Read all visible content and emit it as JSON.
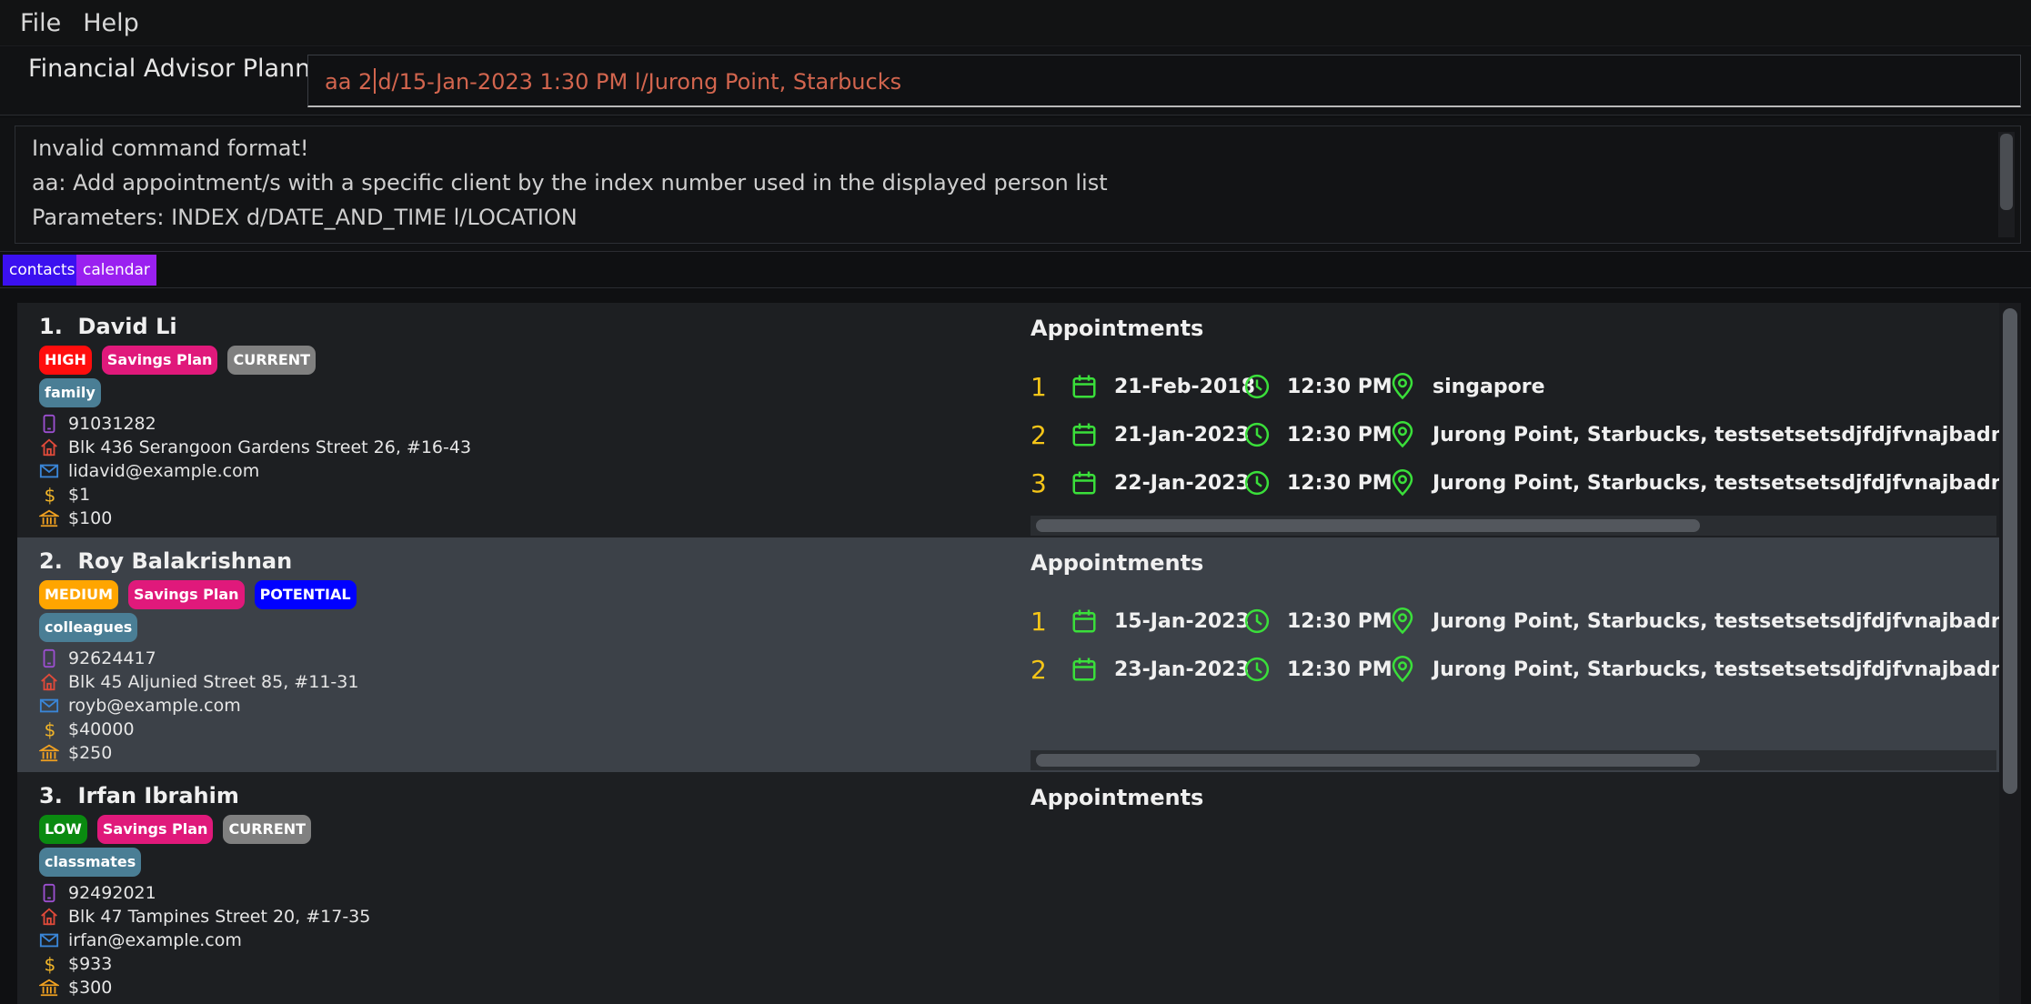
{
  "menu": {
    "file": "File",
    "help": "Help"
  },
  "app_title": "Financial Advisor Planner",
  "command": {
    "before_cursor": "aa 2",
    "after_cursor": "d/15-Jan-2023 1:30 PM l/Jurong Point, Starbucks"
  },
  "result": {
    "line1": "Invalid command format!",
    "line2": "aa: Add appointment/s with a specific client by the index number used in the displayed person list",
    "line3": "Parameters: INDEX d/DATE_AND_TIME l/LOCATION"
  },
  "tabs": {
    "contacts": "contacts",
    "calendar": "calendar"
  },
  "appointments_heading": "Appointments",
  "colors": {
    "high": "#ff0d0d",
    "medium": "#ffa500",
    "low": "#0a8a10",
    "plan": "#e0197b",
    "current": "#808080",
    "potential": "#0000ff",
    "group": "#4a7e95",
    "accent_green": "#3adf3a",
    "index_yellow": "#f5c518"
  },
  "persons": [
    {
      "index": "1.",
      "name": "David Li",
      "risk": "HIGH",
      "plan": "Savings Plan",
      "status": "CURRENT",
      "group": "family",
      "phone": "91031282",
      "address": "Blk 436 Serangoon Gardens Street 26, #16-43",
      "email": "lidavid@example.com",
      "income": "$1",
      "monthly": "$100",
      "appointments": [
        {
          "idx": "1",
          "date": "21-Feb-2018",
          "time": "12:30 PM",
          "location": "singapore"
        },
        {
          "idx": "2",
          "date": "21-Jan-2023",
          "time": "12:30 PM",
          "location": "Jurong Point, Starbucks, testsetsetsdjfdjfvnajbadnb jsdfnvnas"
        },
        {
          "idx": "3",
          "date": "22-Jan-2023",
          "time": "12:30 PM",
          "location": "Jurong Point, Starbucks, testsetsetsdjfdjfvnajbadnb jsdfnvnas"
        }
      ]
    },
    {
      "index": "2.",
      "name": "Roy Balakrishnan",
      "risk": "MEDIUM",
      "plan": "Savings Plan",
      "status": "POTENTIAL",
      "group": "colleagues",
      "phone": "92624417",
      "address": "Blk 45 Aljunied Street 85, #11-31",
      "email": "royb@example.com",
      "income": "$40000",
      "monthly": "$250",
      "appointments": [
        {
          "idx": "1",
          "date": "15-Jan-2023",
          "time": "12:30 PM",
          "location": "Jurong Point, Starbucks, testsetsetsdjfdjfvnajbadnb jsdfnvnas"
        },
        {
          "idx": "2",
          "date": "23-Jan-2023",
          "time": "12:30 PM",
          "location": "Jurong Point, Starbucks, testsetsetsdjfdjfvnajbadnb jsdfnvnas"
        }
      ]
    },
    {
      "index": "3.",
      "name": "Irfan Ibrahim",
      "risk": "LOW",
      "plan": "Savings Plan",
      "status": "CURRENT",
      "group": "classmates",
      "phone": "92492021",
      "address": "Blk 47 Tampines Street 20, #17-35",
      "email": "irfan@example.com",
      "income": "$933",
      "monthly": "$300",
      "appointments": []
    }
  ]
}
